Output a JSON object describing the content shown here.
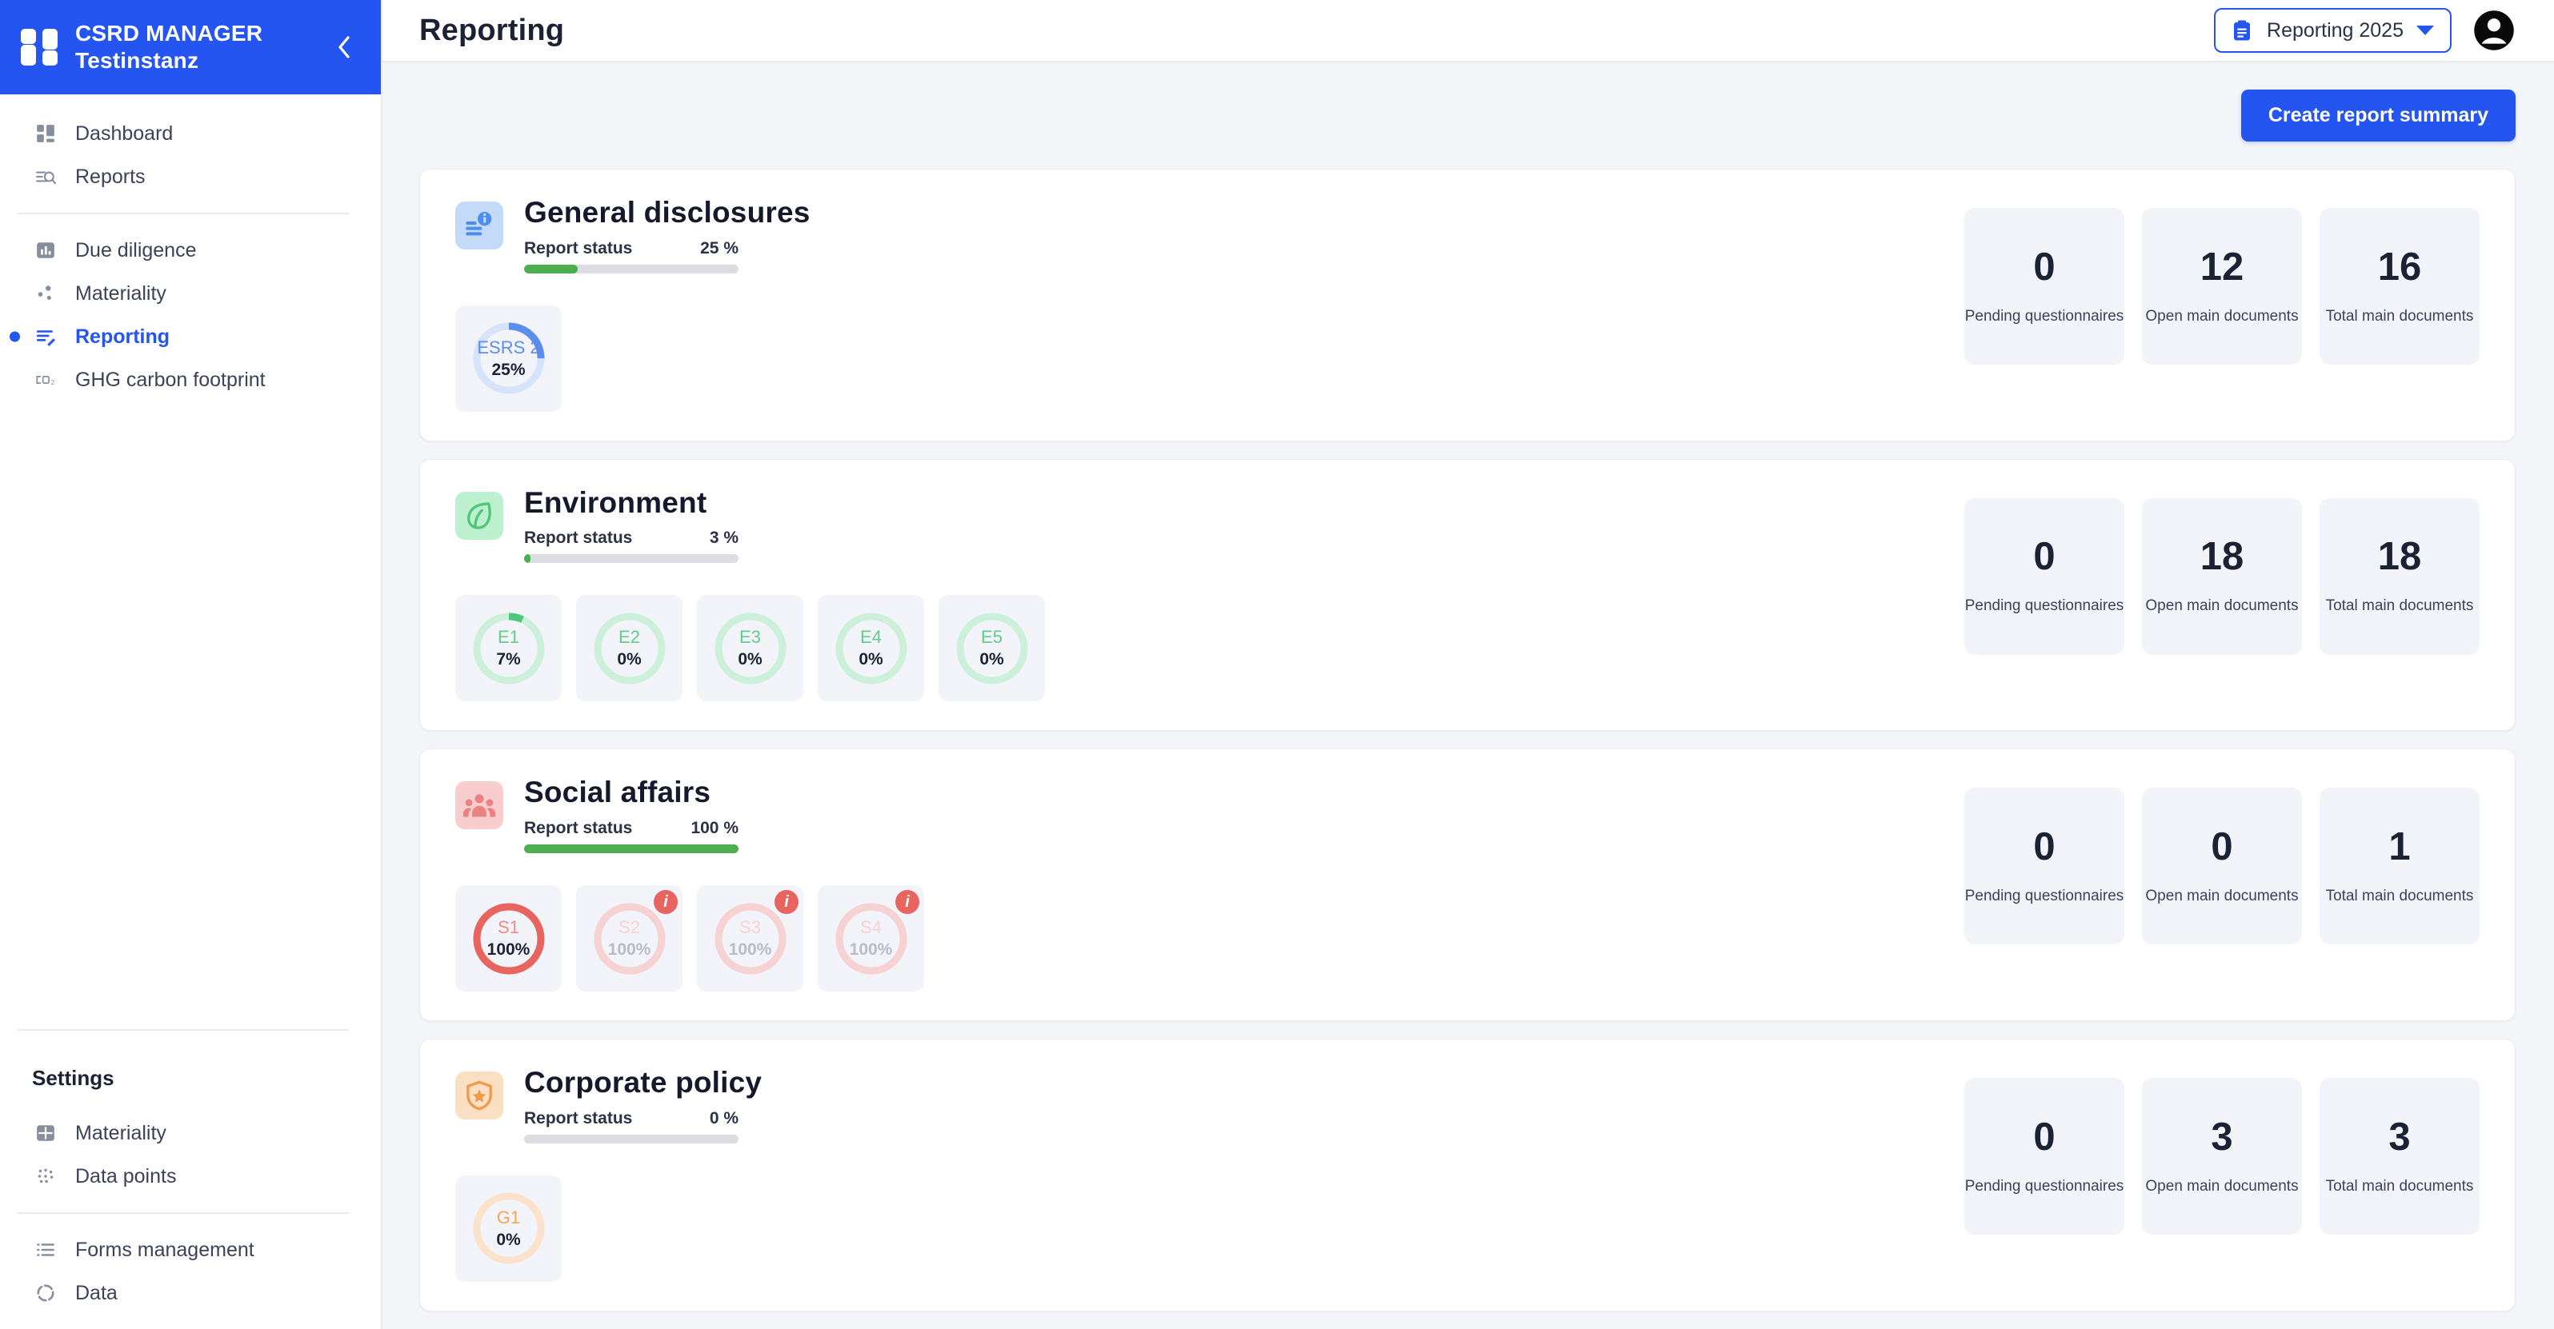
{
  "brand": {
    "title": "CSRD MANAGER",
    "subtitle": "Testinstanz",
    "logo_icon": "grid-squares-icon",
    "collapse_icon": "chevron-left-icon"
  },
  "sidebar": {
    "primary_items": [
      {
        "label": "Dashboard",
        "icon": "dashboard-icon",
        "active": false
      },
      {
        "label": "Reports",
        "icon": "reports-search-icon",
        "active": false
      }
    ],
    "secondary_items": [
      {
        "label": "Due diligence",
        "icon": "bar-chart-icon",
        "active": false
      },
      {
        "label": "Materiality",
        "icon": "scatter-dots-icon",
        "active": false
      },
      {
        "label": "Reporting",
        "icon": "list-edit-icon",
        "active": true
      },
      {
        "label": "GHG carbon footprint",
        "icon": "co2-icon",
        "active": false
      }
    ],
    "settings_title": "Settings",
    "settings_items": [
      {
        "label": "Materiality",
        "icon": "grid-table-icon"
      },
      {
        "label": "Data points",
        "icon": "data-points-icon"
      }
    ],
    "settings_items_2": [
      {
        "label": "Forms management",
        "icon": "list-bullet-icon"
      },
      {
        "label": "Data",
        "icon": "circle-dashed-icon"
      }
    ]
  },
  "header": {
    "page_title": "Reporting",
    "period_selector": {
      "value": "Reporting 2025",
      "icon": "clipboard-icon",
      "caret_icon": "chevron-down-icon"
    },
    "avatar_icon": "account-circle-icon"
  },
  "toolbar": {
    "create_summary_label": "Create report summary"
  },
  "stat_labels": {
    "pending": "Pending questionnaires",
    "open": "Open main documents",
    "total": "Total main documents"
  },
  "status_label": "Report status",
  "colors": {
    "brand_blue": "#2455f0",
    "progress_green": "#4caf50",
    "blue_accent": "#5b8def",
    "blue_track": "#d6e4fb",
    "green_accent": "#4cc878",
    "green_track": "#cdf0da",
    "red_accent": "#e8645f",
    "red_track": "#f6d2d2",
    "orange_accent": "#f5a556",
    "orange_track": "#fbe3cb",
    "badge_red": "#e8645f"
  },
  "cards": [
    {
      "title": "General disclosures",
      "icon": "document-info-icon",
      "icon_theme": "blue",
      "status_pct_text": "25 %",
      "status_pct": 25,
      "donuts": [
        {
          "code": "ESRS 2",
          "pct_text": "25%",
          "pct": 25,
          "theme": "blue",
          "muted": false,
          "badge": null
        }
      ],
      "stats": {
        "pending": "0",
        "open": "12",
        "total": "16"
      }
    },
    {
      "title": "Environment",
      "icon": "leaf-icon",
      "icon_theme": "green",
      "status_pct_text": "3 %",
      "status_pct": 3,
      "donuts": [
        {
          "code": "E1",
          "pct_text": "7%",
          "pct": 7,
          "theme": "green",
          "muted": false,
          "badge": null
        },
        {
          "code": "E2",
          "pct_text": "0%",
          "pct": 0,
          "theme": "green",
          "muted": false,
          "badge": null
        },
        {
          "code": "E3",
          "pct_text": "0%",
          "pct": 0,
          "theme": "green",
          "muted": false,
          "badge": null
        },
        {
          "code": "E4",
          "pct_text": "0%",
          "pct": 0,
          "theme": "green",
          "muted": false,
          "badge": null
        },
        {
          "code": "E5",
          "pct_text": "0%",
          "pct": 0,
          "theme": "green",
          "muted": false,
          "badge": null
        }
      ],
      "stats": {
        "pending": "0",
        "open": "18",
        "total": "18"
      }
    },
    {
      "title": "Social affairs",
      "icon": "people-group-icon",
      "icon_theme": "red",
      "status_pct_text": "100 %",
      "status_pct": 100,
      "donuts": [
        {
          "code": "S1",
          "pct_text": "100%",
          "pct": 100,
          "theme": "red",
          "muted": false,
          "badge": null
        },
        {
          "code": "S2",
          "pct_text": "100%",
          "pct": 100,
          "theme": "red",
          "muted": true,
          "badge": "i"
        },
        {
          "code": "S3",
          "pct_text": "100%",
          "pct": 100,
          "theme": "red",
          "muted": true,
          "badge": "i"
        },
        {
          "code": "S4",
          "pct_text": "100%",
          "pct": 100,
          "theme": "red",
          "muted": true,
          "badge": "i"
        }
      ],
      "stats": {
        "pending": "0",
        "open": "0",
        "total": "1"
      }
    },
    {
      "title": "Corporate policy",
      "icon": "shield-star-icon",
      "icon_theme": "orange",
      "status_pct_text": "0 %",
      "status_pct": 0,
      "donuts": [
        {
          "code": "G1",
          "pct_text": "0%",
          "pct": 0,
          "theme": "orange",
          "muted": false,
          "badge": null
        }
      ],
      "stats": {
        "pending": "0",
        "open": "3",
        "total": "3"
      }
    }
  ]
}
